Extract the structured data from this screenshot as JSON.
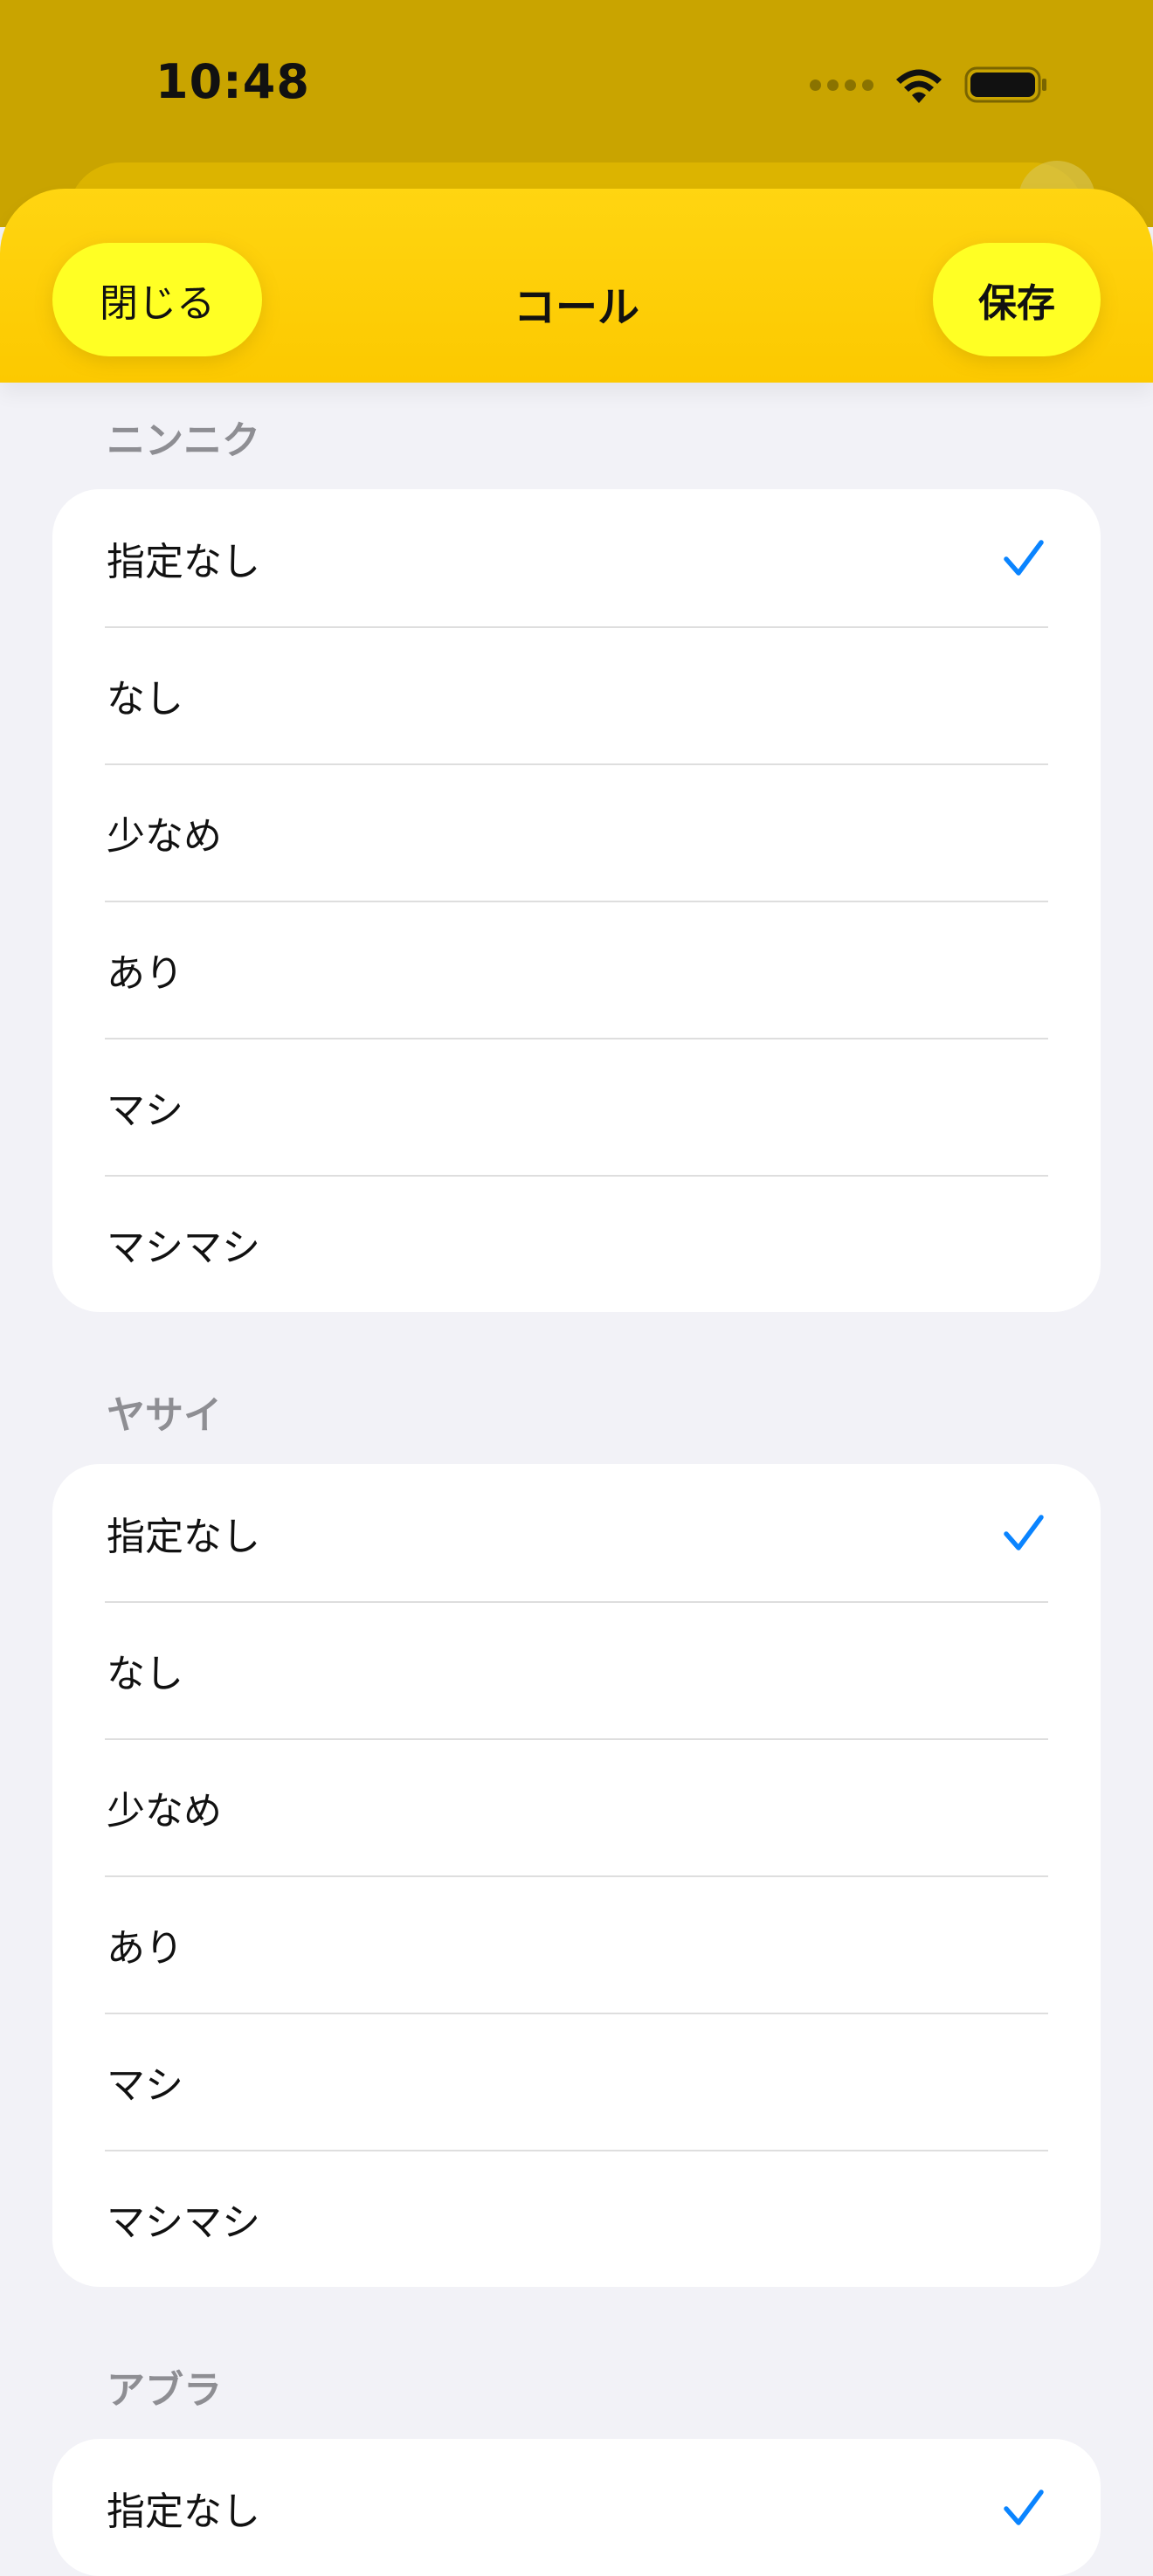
{
  "status_bar": {
    "time": "10:48"
  },
  "header": {
    "close_label": "閉じる",
    "title": "コール",
    "save_label": "保存"
  },
  "sections": [
    {
      "title": "ニンニク",
      "options": [
        "指定なし",
        "なし",
        "少なめ",
        "あり",
        "マシ",
        "マシマシ"
      ],
      "selected": "指定なし"
    },
    {
      "title": "ヤサイ",
      "options": [
        "指定なし",
        "なし",
        "少なめ",
        "あり",
        "マシ",
        "マシマシ"
      ],
      "selected": "指定なし"
    },
    {
      "title": "アブラ",
      "options": [
        "指定なし"
      ],
      "selected": "指定なし"
    }
  ],
  "colors": {
    "accent": "#0a84ff",
    "header_yellow": "#ffd511",
    "button_yellow": "#ffff24",
    "backdrop": "#c9a400"
  },
  "icons": {
    "check": "checkmark-icon",
    "wifi": "wifi-icon",
    "battery": "battery-icon",
    "signal": "cellular-signal-icon"
  }
}
